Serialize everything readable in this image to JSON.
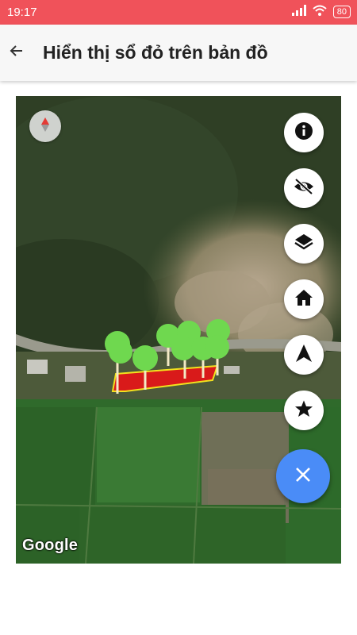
{
  "status_bar": {
    "time": "19:17",
    "battery": "80"
  },
  "app_bar": {
    "title": "Hiển thị sổ đỏ trên bản đồ"
  },
  "map": {
    "attribution": "Google",
    "parcel_color": "#d91a1a",
    "parcel_border": "#f2e21e",
    "tree_color": "#6fd84f"
  },
  "map_controls": [
    {
      "name": "info-button",
      "icon": "info-icon"
    },
    {
      "name": "toggle-visibility-button",
      "icon": "eye-off-icon"
    },
    {
      "name": "layers-button",
      "icon": "layers-icon"
    },
    {
      "name": "home-button",
      "icon": "home-icon"
    },
    {
      "name": "navigation-button",
      "icon": "navigation-arrow-icon"
    },
    {
      "name": "favorite-button",
      "icon": "star-icon"
    }
  ],
  "fab": {
    "icon": "close-icon",
    "color": "#4a8cf7"
  }
}
